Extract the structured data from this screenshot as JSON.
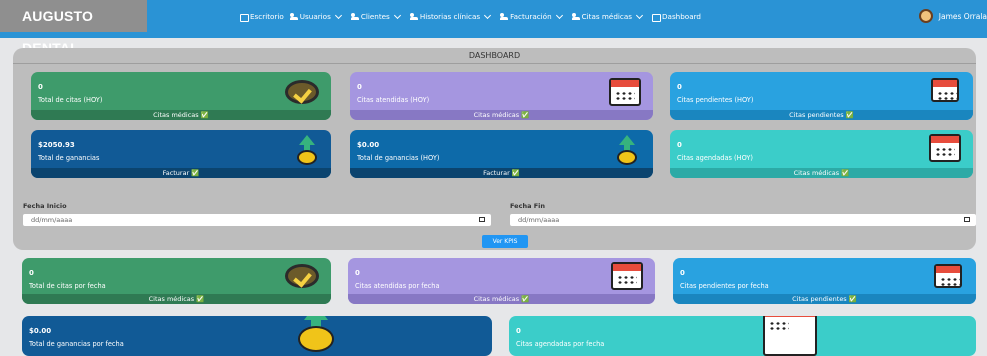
{
  "app": {
    "brand": "AUGUSTO DENTAL",
    "user_name": "James Orrala"
  },
  "nav": [
    {
      "label": "Escritorio",
      "icon": "home-icon",
      "caret": false
    },
    {
      "label": "Usuarios",
      "icon": "users-icon",
      "caret": true
    },
    {
      "label": "Clientes",
      "icon": "users-icon",
      "caret": true
    },
    {
      "label": "Historias clínicas",
      "icon": "users-icon",
      "caret": true
    },
    {
      "label": "Facturación",
      "icon": "users-icon",
      "caret": true
    },
    {
      "label": "Citas médicas",
      "icon": "users-icon",
      "caret": true
    },
    {
      "label": "Dashboard",
      "icon": "home-icon",
      "caret": false
    }
  ],
  "dashboard": {
    "title": "DASHBOARD",
    "cards": [
      {
        "value": "0",
        "label": "Total de citas (HOY)",
        "footer": "Citas médicas ✅",
        "color": "green",
        "icon": "check-circle-icon"
      },
      {
        "value": "0",
        "label": "Citas atendidas (HOY)",
        "footer": "Citas médicas ✅",
        "color": "purple",
        "icon": "calendar-tooth-icon"
      },
      {
        "value": "0",
        "label": "Citas pendientes (HOY)",
        "footer": "Citas pendientes ✅",
        "color": "blue",
        "icon": "calendar-pending-icon"
      },
      {
        "value": "$2050.93",
        "label": "Total de ganancias",
        "footer": "Facturar ✅",
        "color": "navy",
        "icon": "money-up-icon"
      },
      {
        "value": "$0.00",
        "label": "Total de ganancias (HOY)",
        "footer": "Facturar ✅",
        "color": "navy",
        "icon": "money-bag-icon"
      },
      {
        "value": "0",
        "label": "Citas agendadas (HOY)",
        "footer": "Citas médicas ✅",
        "color": "teal",
        "icon": "calendar-tooth-icon"
      }
    ]
  },
  "filters": {
    "start_label": "Fecha Inicio",
    "end_label": "Fecha Fin",
    "start_placeholder": "dd/mm/aaaa",
    "end_placeholder": "dd/mm/aaaa",
    "button": "Ver KPIS"
  },
  "results": {
    "cards": [
      {
        "value": "0",
        "label": "Total de citas por fecha",
        "footer": "Citas médicas ✅",
        "color": "green",
        "icon": "check-circle-icon"
      },
      {
        "value": "0",
        "label": "Citas atendidas por fecha",
        "footer": "Citas médicas ✅",
        "color": "purple",
        "icon": "calendar-tooth-icon"
      },
      {
        "value": "0",
        "label": "Citas pendientes por fecha",
        "footer": "Citas pendientes ✅",
        "color": "blue",
        "icon": "calendar-pending-icon"
      },
      {
        "value": "$0.00",
        "label": "Total de ganancias por fecha",
        "footer": "",
        "color": "navy",
        "icon": "money-up-icon"
      },
      {
        "value": "0",
        "label": "Citas agendadas por fecha",
        "footer": "",
        "color": "teal",
        "icon": "calendar-tooth-icon"
      }
    ]
  }
}
